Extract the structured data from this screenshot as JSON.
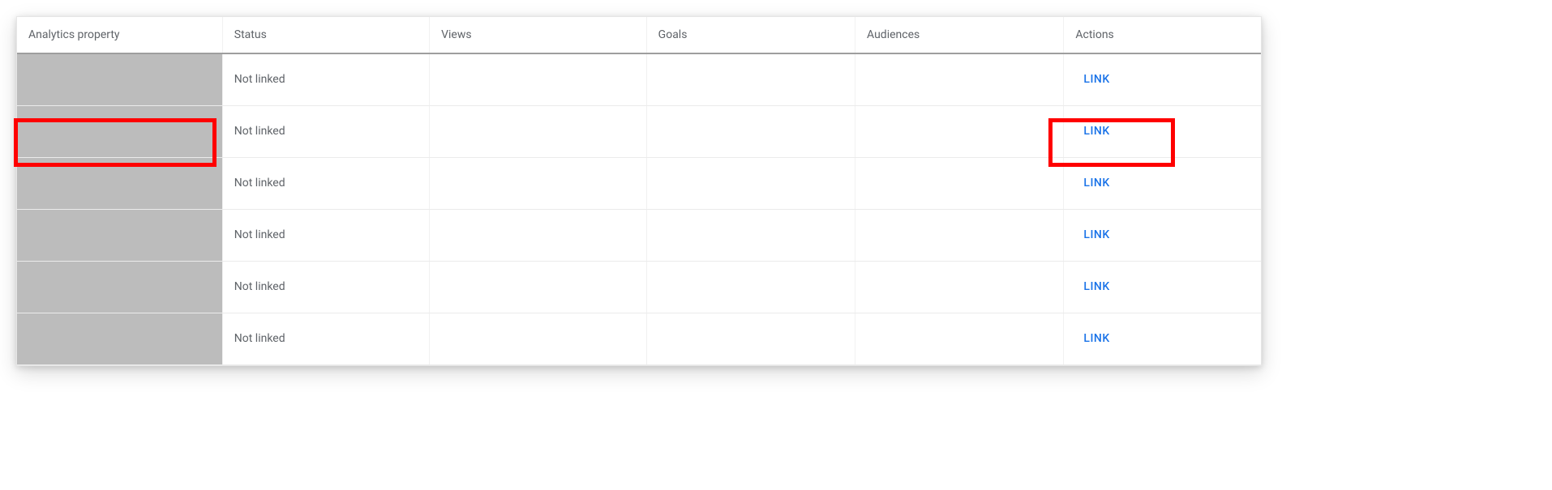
{
  "columns": {
    "property": "Analytics property",
    "status": "Status",
    "views": "Views",
    "goals": "Goals",
    "aud": "Audiences",
    "actions": "Actions"
  },
  "rows": [
    {
      "property": "",
      "status": "Not linked",
      "views": "",
      "goals": "",
      "aud": "",
      "action": "LINK",
      "highlighted": false
    },
    {
      "property": "",
      "status": "Not linked",
      "views": "",
      "goals": "",
      "aud": "",
      "action": "LINK",
      "highlighted": true
    },
    {
      "property": "",
      "status": "Not linked",
      "views": "",
      "goals": "",
      "aud": "",
      "action": "LINK",
      "highlighted": false
    },
    {
      "property": "",
      "status": "Not linked",
      "views": "",
      "goals": "",
      "aud": "",
      "action": "LINK",
      "highlighted": false
    },
    {
      "property": "",
      "status": "Not linked",
      "views": "",
      "goals": "",
      "aud": "",
      "action": "LINK",
      "highlighted": false
    },
    {
      "property": "",
      "status": "Not linked",
      "views": "",
      "goals": "",
      "aud": "",
      "action": "LINK",
      "highlighted": false
    }
  ]
}
